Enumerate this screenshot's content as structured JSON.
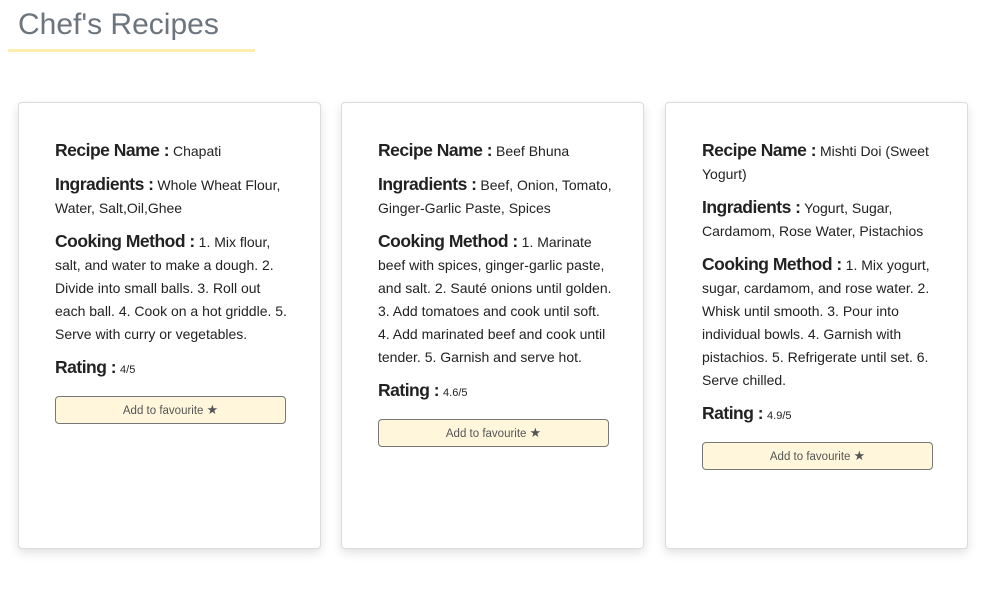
{
  "header": {
    "title": "Chef's Recipes"
  },
  "labels": {
    "name": "Recipe Name :",
    "ingredients": "Ingradients :",
    "method": "Cooking Method :",
    "rating": "Rating :",
    "favourite": "Add to favourite"
  },
  "recipes": [
    {
      "name": "Chapati",
      "ingredients": "Whole Wheat Flour, Water, Salt,Oil,Ghee",
      "method": "1. Mix flour, salt, and water to make a dough. 2. Divide into small balls. 3. Roll out each ball. 4. Cook on a hot griddle. 5. Serve with curry or vegetables.",
      "rating": "4/5"
    },
    {
      "name": "Beef Bhuna",
      "ingredients": "Beef, Onion, Tomato, Ginger-Garlic Paste, Spices",
      "method": "1. Marinate beef with spices, ginger-garlic paste, and salt. 2. Sauté onions until golden. 3. Add tomatoes and cook until soft. 4. Add marinated beef and cook until tender. 5. Garnish and serve hot.",
      "rating": "4.6/5"
    },
    {
      "name": "Mishti Doi (Sweet Yogurt)",
      "ingredients": "Yogurt, Sugar, Cardamom, Rose Water, Pistachios",
      "method": "1. Mix yogurt, sugar, cardamom, and rose water. 2. Whisk until smooth. 3. Pour into individual bowls. 4. Garnish with pistachios. 5. Refrigerate until set. 6. Serve chilled.",
      "rating": "4.9/5"
    }
  ]
}
